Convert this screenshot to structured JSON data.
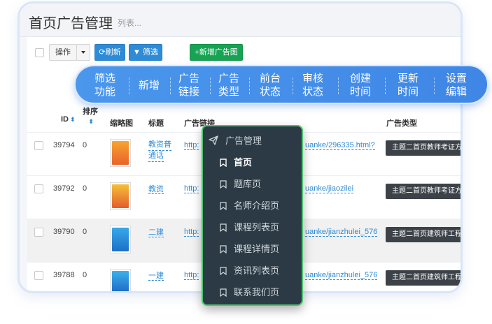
{
  "page": {
    "title": "首页广告管理",
    "subtitle": "列表..."
  },
  "toolbar": {
    "action_label": "操作",
    "refresh_label": "刷新",
    "filter_label": "筛选",
    "add_label": "新增广告图"
  },
  "table": {
    "headers": {
      "id": "ID",
      "sort_line1": "排序",
      "thumb": "缩略图",
      "title": "标题",
      "link": "广告链接",
      "type": "广告类型"
    },
    "rows": [
      {
        "id": "39794",
        "sort": "0",
        "title_line1": "教资普",
        "title_line2": "通话",
        "link_prefix": "http:",
        "link_suffix": "uanke/296335.html?",
        "type": "主题二首页教师考证方"
      },
      {
        "id": "39792",
        "sort": "0",
        "title_line1": "教资",
        "title_line2": "",
        "link_prefix": "http:",
        "link_suffix": "uanke/jiaozilei",
        "type": "主题二首页教师考证方"
      },
      {
        "id": "39790",
        "sort": "0",
        "title_line1": "二建",
        "title_line2": "",
        "link_prefix": "http:",
        "link_suffix": "uanke/jianzhulei_576",
        "type": "主题二首页建筑师工程"
      },
      {
        "id": "39788",
        "sort": "0",
        "title_line1": "一建",
        "title_line2": "",
        "link_prefix": "http:",
        "link_suffix": "uanke/jianzhulei_576",
        "type": "主题二首页建筑师工程"
      }
    ]
  },
  "features": [
    {
      "line1": "筛选",
      "line2": "功能"
    },
    {
      "line1": "新增",
      "line2": ""
    },
    {
      "line1": "广告",
      "line2": "链接"
    },
    {
      "line1": "广告",
      "line2": "类型"
    },
    {
      "line1": "前台",
      "line2": "状态"
    },
    {
      "line1": "审核",
      "line2": "状态"
    },
    {
      "line1": "创建",
      "line2": "时间"
    },
    {
      "line1": "更新",
      "line2": "时间"
    },
    {
      "line1": "设置",
      "line2": "编辑"
    }
  ],
  "menu": {
    "header": "广告管理",
    "items": [
      "首页",
      "题库页",
      "名师介绍页",
      "课程列表页",
      "课程详情页",
      "资讯列表页",
      "联系我们页"
    ],
    "active": "首页"
  },
  "colors": {
    "accent": "#3f86e6",
    "menu_bg": "#2b3a44",
    "menu_border": "#4cc46f",
    "primary_button": "#2f8bd6",
    "success_button": "#18a354"
  }
}
